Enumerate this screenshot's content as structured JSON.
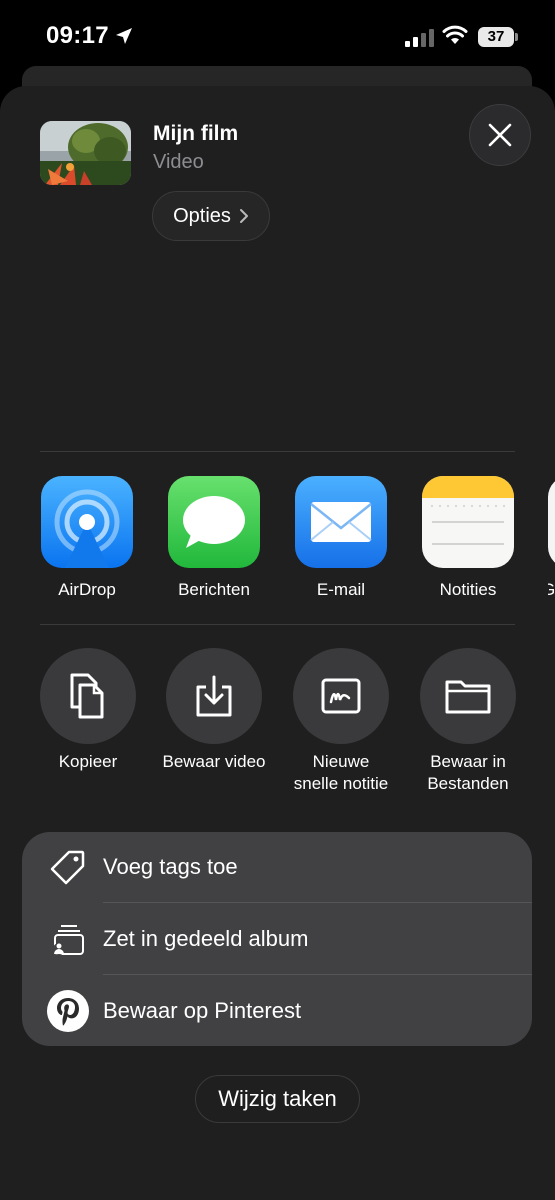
{
  "status_bar": {
    "time": "09:17",
    "battery": "37",
    "icons": [
      "location-icon",
      "signal-icon",
      "wifi-icon",
      "battery-icon"
    ]
  },
  "header": {
    "title": "Mijn film",
    "subtitle": "Video",
    "options_label": "Opties",
    "close_icon": "close-icon"
  },
  "apps": [
    {
      "label": "AirDrop",
      "icon": "airdrop-icon",
      "color": "#1a8cff"
    },
    {
      "label": "Berichten",
      "icon": "messages-icon",
      "color": "#34c759"
    },
    {
      "label": "E-mail",
      "icon": "mail-icon",
      "color": "#1e88f5"
    },
    {
      "label": "Notities",
      "icon": "notes-icon",
      "color": "#ffd43b"
    },
    {
      "label": "G",
      "icon": "partial-app-icon"
    }
  ],
  "actions": [
    {
      "label": "Kopieer",
      "icon": "copy-icon"
    },
    {
      "label": "Bewaar video",
      "icon": "save-video-icon"
    },
    {
      "label": "Nieuwe\nsnelle notitie",
      "line1": "Nieuwe",
      "line2": "snelle notitie",
      "icon": "quick-note-icon"
    },
    {
      "label": "Bewaar in\nBestanden",
      "line1": "Bewaar in",
      "line2": "Bestanden",
      "icon": "folder-icon"
    }
  ],
  "list": [
    {
      "label": "Voeg tags toe",
      "icon": "tag-icon"
    },
    {
      "label": "Zet in gedeeld album",
      "icon": "shared-album-icon"
    },
    {
      "label": "Bewaar op Pinterest",
      "icon": "pinterest-icon"
    }
  ],
  "edit_actions_label": "Wijzig taken"
}
